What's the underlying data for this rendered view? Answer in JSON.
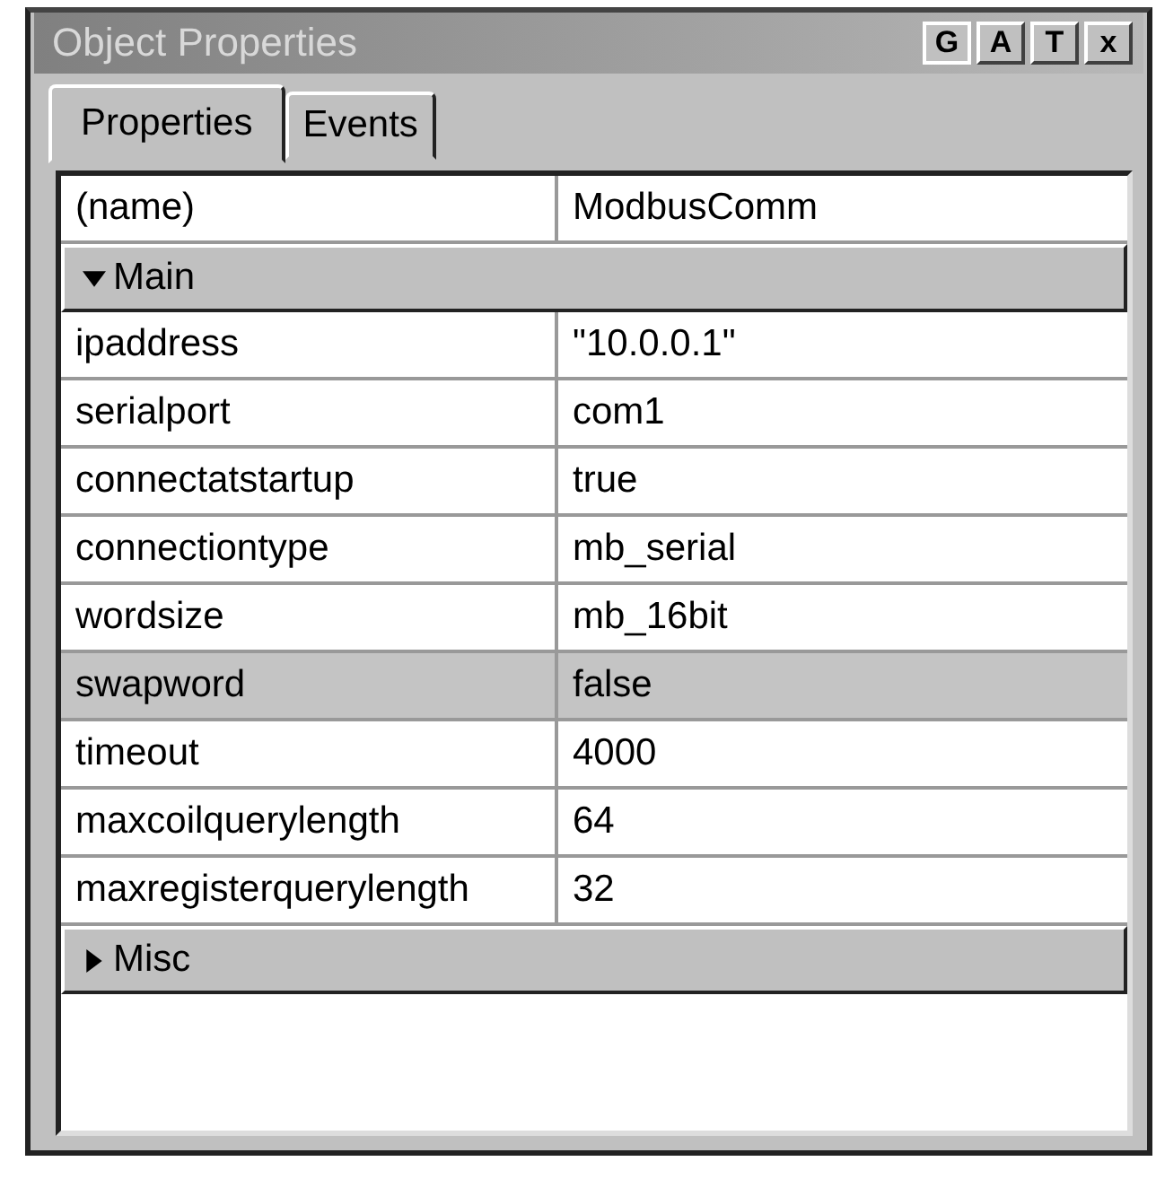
{
  "window": {
    "title": "Object Properties",
    "buttons": [
      {
        "label": "G",
        "pressed": true
      },
      {
        "label": "A",
        "pressed": false
      },
      {
        "label": "T",
        "pressed": false
      },
      {
        "label": "x",
        "pressed": false
      }
    ]
  },
  "tabs": [
    {
      "label": "Properties",
      "selected": true
    },
    {
      "label": "Events",
      "selected": false
    }
  ],
  "grid": {
    "rows": [
      {
        "kind": "property",
        "name": "(name)",
        "value": "ModbusComm",
        "selected": false
      },
      {
        "kind": "category",
        "name": "Main",
        "expanded": true
      },
      {
        "kind": "property",
        "name": "ipaddress",
        "value": "\"10.0.0.1\"",
        "selected": false
      },
      {
        "kind": "property",
        "name": "serialport",
        "value": "com1",
        "selected": false
      },
      {
        "kind": "property",
        "name": "connectatstartup",
        "value": "true",
        "selected": false
      },
      {
        "kind": "property",
        "name": "connectiontype",
        "value": "mb_serial",
        "selected": false
      },
      {
        "kind": "property",
        "name": "wordsize",
        "value": "mb_16bit",
        "selected": false
      },
      {
        "kind": "property",
        "name": "swapword",
        "value": "false",
        "selected": true
      },
      {
        "kind": "property",
        "name": "timeout",
        "value": "4000",
        "selected": false
      },
      {
        "kind": "property",
        "name": "maxcoilquerylength",
        "value": "64",
        "selected": false
      },
      {
        "kind": "property",
        "name": "maxregisterquerylength",
        "value": "32",
        "selected": false
      },
      {
        "kind": "category",
        "name": "Misc",
        "expanded": false
      }
    ]
  }
}
